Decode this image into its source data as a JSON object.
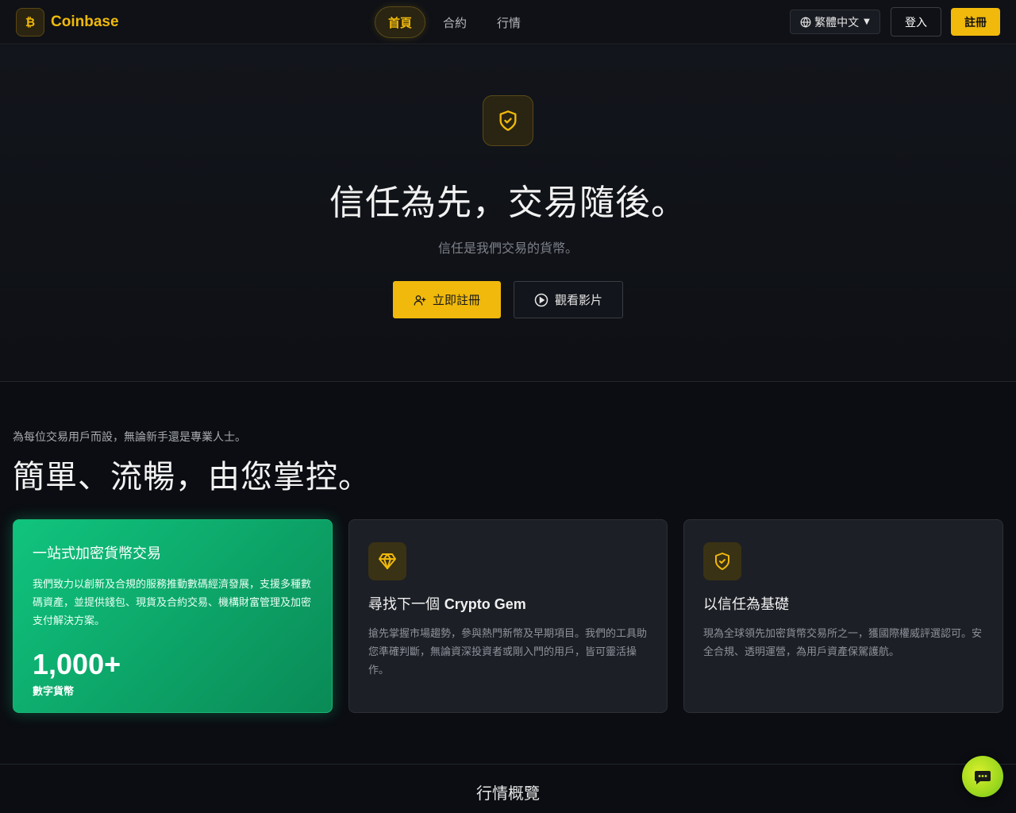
{
  "brand": {
    "name": "Coinbase",
    "accent": "#f0b90b"
  },
  "nav": {
    "links": [
      {
        "label": "首頁",
        "active": true
      },
      {
        "label": "合約",
        "active": false
      },
      {
        "label": "行情",
        "active": false
      }
    ],
    "language": "繁體中文",
    "login_label": "登入",
    "signup_label": "註冊"
  },
  "hero": {
    "title": "信任為先，交易隨後。",
    "subtitle": "信任是我們交易的貨幣。",
    "primary_cta": "立即註冊",
    "secondary_cta": "觀看影片"
  },
  "features": {
    "kicker": "為每位交易用戶而設，無論新手還是專業人士。",
    "title": "簡單、流暢，由您掌控。",
    "cards": [
      {
        "title": "一站式加密貨幣交易",
        "body": "我們致力以創新及合規的服務推動數碼經濟發展，支援多種數碼資產，並提供錢包、現貨及合約交易、機構財富管理及加密支付解決方案。",
        "stat": "1,000+",
        "stat_label": "數字貨幣",
        "color": "#10c47e"
      },
      {
        "title_prefix": "尋找下一個 ",
        "title_emph": "Crypto Gem",
        "body": "搶先掌握市場趨勢，參與熱門新幣及早期項目。我們的工具助您準確判斷，無論資深投資者或剛入門的用戶，皆可靈活操作。",
        "icon": "diamond-icon"
      },
      {
        "title": "以信任為基礎",
        "body": "現為全球領先加密貨幣交易所之一，獲國際權威評選認可。安全合規、透明運營，為用戶資產保駕護航。",
        "icon": "shield-check-icon"
      }
    ]
  },
  "market": {
    "title": "行情概覽"
  }
}
